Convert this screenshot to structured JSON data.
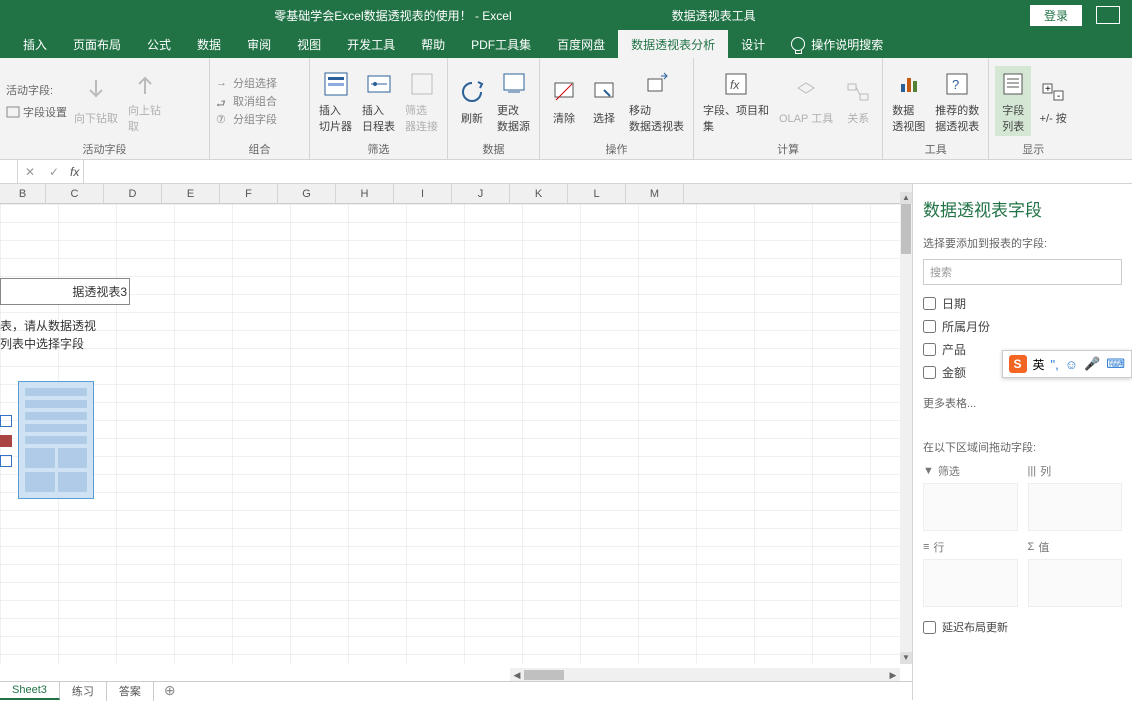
{
  "title": {
    "doc": "零基础学会Excel数据透视表的使用！  -  Excel",
    "context": "数据透视表工具",
    "login": "登录"
  },
  "tabs": [
    "插入",
    "页面布局",
    "公式",
    "数据",
    "审阅",
    "视图",
    "开发工具",
    "帮助",
    "PDF工具集",
    "百度网盘",
    "数据透视表分析",
    "设计"
  ],
  "help_hint": "操作说明搜索",
  "ribbon": {
    "g1": {
      "label": "活动字段",
      "field_label": "活动字段:",
      "settings": "字段设置",
      "down": "向下钻取",
      "up": "向上钻\n取"
    },
    "g2": {
      "label": "组合",
      "a": "分组选择",
      "b": "取消组合",
      "c": "分组字段"
    },
    "g3": {
      "label": "筛选",
      "slice": "插入\n切片器",
      "time": "插入\n日程表",
      "conn": "筛选\n器连接"
    },
    "g4": {
      "label": "数据",
      "refresh": "刷新",
      "change": "更改\n数据源"
    },
    "g5": {
      "label": "操作",
      "clear": "清除",
      "select": "选择",
      "move": "移动\n数据透视表"
    },
    "g6": {
      "label": "计算",
      "field": "字段、项目和\n集",
      "olap": "OLAP 工具",
      "rel": "关系"
    },
    "g7": {
      "label": "工具",
      "chart": "数据\n透视图",
      "rec": "推荐的数\n据透视表"
    },
    "g8": {
      "label": "显示",
      "list": "字段\n列表",
      "pm": "+/- 按"
    }
  },
  "columns": [
    "B",
    "C",
    "D",
    "E",
    "F",
    "G",
    "H",
    "I",
    "J",
    "K",
    "L",
    "M"
  ],
  "overlay": {
    "name": "据透视表3",
    "text1": "表，请从数据透视",
    "text2": "列表中选择字段"
  },
  "sheets": [
    "Sheet3",
    "练习",
    "答案"
  ],
  "pane": {
    "title": "数据透视表字段",
    "subtitle": "选择要添加到报表的字段:",
    "search": "搜索",
    "fields": [
      "日期",
      "所属月份",
      "产品",
      "金额"
    ],
    "more": "更多表格...",
    "areas_title": "在以下区域间拖动字段:",
    "filter": "筛选",
    "col": "列",
    "row": "行",
    "val": "值",
    "defer": "延迟布局更新"
  },
  "sogou": {
    "lang": "英"
  }
}
